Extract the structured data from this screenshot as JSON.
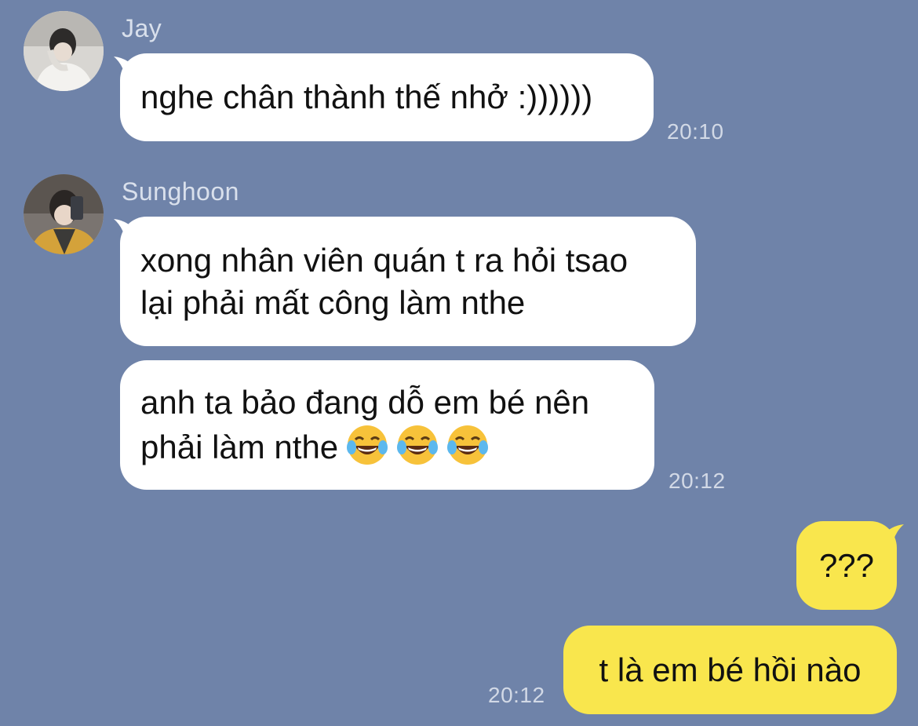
{
  "messages": [
    {
      "sender": "Jay",
      "text": "nghe chân thành thế nhở :))))))",
      "time": "20:10",
      "avatar_icon": "jay-avatar-photo"
    },
    {
      "sender": "Sunghoon",
      "text_line1": "xong nhân viên quán t ra hỏi tsao",
      "text_line2": "lại phải mất công làm nthe",
      "avatar_icon": "sunghoon-avatar-photo"
    },
    {
      "text_line1": "anh ta bảo đang dỗ em bé nên",
      "text_line2": "phải làm nthe",
      "emoji": "face-with-tears-of-joy-icon",
      "emoji_count": 3,
      "time": "20:12"
    },
    {
      "text": "???",
      "outgoing": true
    },
    {
      "text": "t là em bé hồi nào",
      "time": "20:12",
      "outgoing": true
    }
  ],
  "colors": {
    "background": "#6f83a9",
    "incoming_bubble": "#ffffff",
    "outgoing_bubble": "#f9e64d"
  }
}
